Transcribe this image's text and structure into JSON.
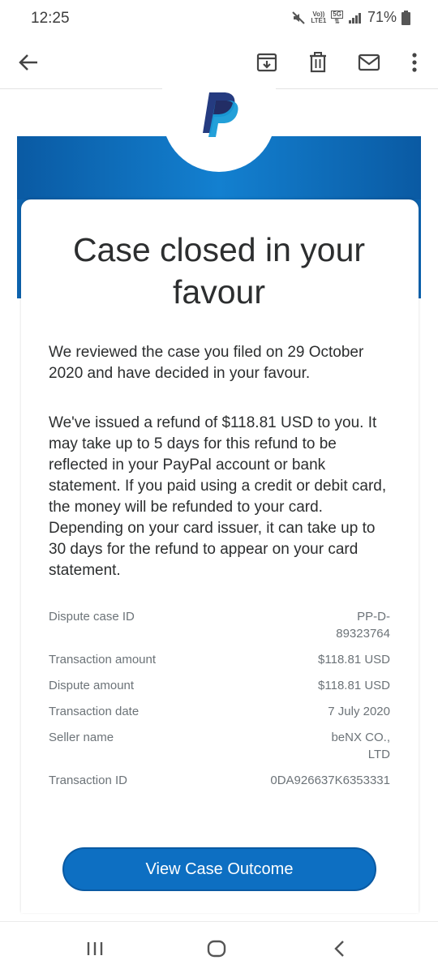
{
  "status_bar": {
    "time": "12:25",
    "volte_top": "Vo))",
    "volte_bottom": "LTE1",
    "network": "5G",
    "battery": "71%"
  },
  "toolbar": {
    "icons": [
      "back-arrow-icon",
      "archive-icon",
      "delete-icon",
      "mark-unread-icon",
      "more-vert-icon"
    ]
  },
  "brand": {
    "colors": {
      "primary": "#0d6fc2",
      "dark": "#0a5aa3",
      "logo_dark": "#253b80",
      "logo_light": "#179bd7"
    }
  },
  "email": {
    "headline": "Case closed in your favour",
    "paragraph1": "We reviewed the case you filed on 29 October 2020 and have decided in your favour.",
    "paragraph2": "We've issued a refund of $118.81 USD to you. It may take up to 5 days for this refund to be reflected in your PayPal account or bank statement. If you paid using a credit or debit card, the money will be refunded to your card. Depending on your card issuer, it can take up to 30 days for the refund to appear on your card statement.",
    "details": [
      {
        "label": "Dispute case ID",
        "value": "PP-D-\n89323764"
      },
      {
        "label": "Transaction amount",
        "value": "$118.81 USD"
      },
      {
        "label": "Dispute amount",
        "value": "$118.81 USD"
      },
      {
        "label": "Transaction date",
        "value": "7 July 2020"
      },
      {
        "label": "Seller name",
        "value": "beNX CO.,\nLTD"
      },
      {
        "label": "Transaction ID",
        "value": "0DA926637K6353331"
      }
    ],
    "cta_label": "View Case Outcome"
  },
  "navbar": {
    "icons": [
      "recent-apps-icon",
      "home-icon",
      "back-icon"
    ]
  }
}
